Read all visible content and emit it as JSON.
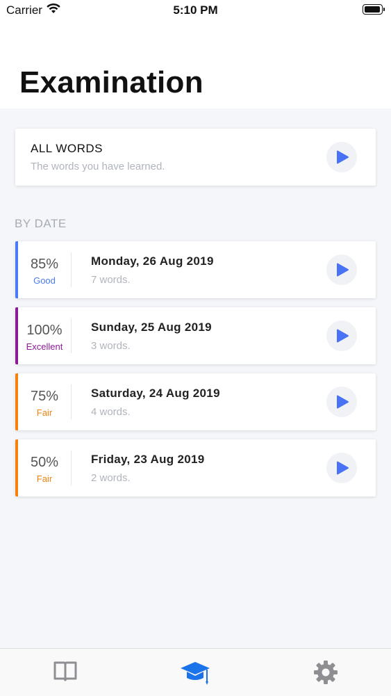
{
  "status_bar": {
    "carrier": "Carrier",
    "time": "5:10 PM"
  },
  "header": {
    "title": "Examination"
  },
  "all_words": {
    "label": "ALL WORDS",
    "subtitle": "The words you have learned."
  },
  "by_date": {
    "header": "BY DATE",
    "items": [
      {
        "percent": "85%",
        "grade": "Good",
        "date": "Monday, 26 Aug 2019",
        "count": "7 words.",
        "color": "#4a7bf5"
      },
      {
        "percent": "100%",
        "grade": "Excellent",
        "date": "Sunday, 25 Aug 2019",
        "count": "3 words.",
        "color": "#8b1a96"
      },
      {
        "percent": "75%",
        "grade": "Fair",
        "date": "Saturday, 24 Aug 2019",
        "count": "4 words.",
        "color": "#f5820f"
      },
      {
        "percent": "50%",
        "grade": "Fair",
        "date": "Friday, 23 Aug 2019",
        "count": "2 words.",
        "color": "#f5820f"
      }
    ]
  },
  "tab_bar": {
    "tabs": [
      {
        "icon": "book-icon",
        "selected": false
      },
      {
        "icon": "graduation-cap-icon",
        "selected": true
      },
      {
        "icon": "gear-icon",
        "selected": false
      }
    ],
    "active_color": "#1a73e8",
    "inactive_color": "#8e8e93"
  },
  "colors": {
    "play": "#4a72f5"
  }
}
